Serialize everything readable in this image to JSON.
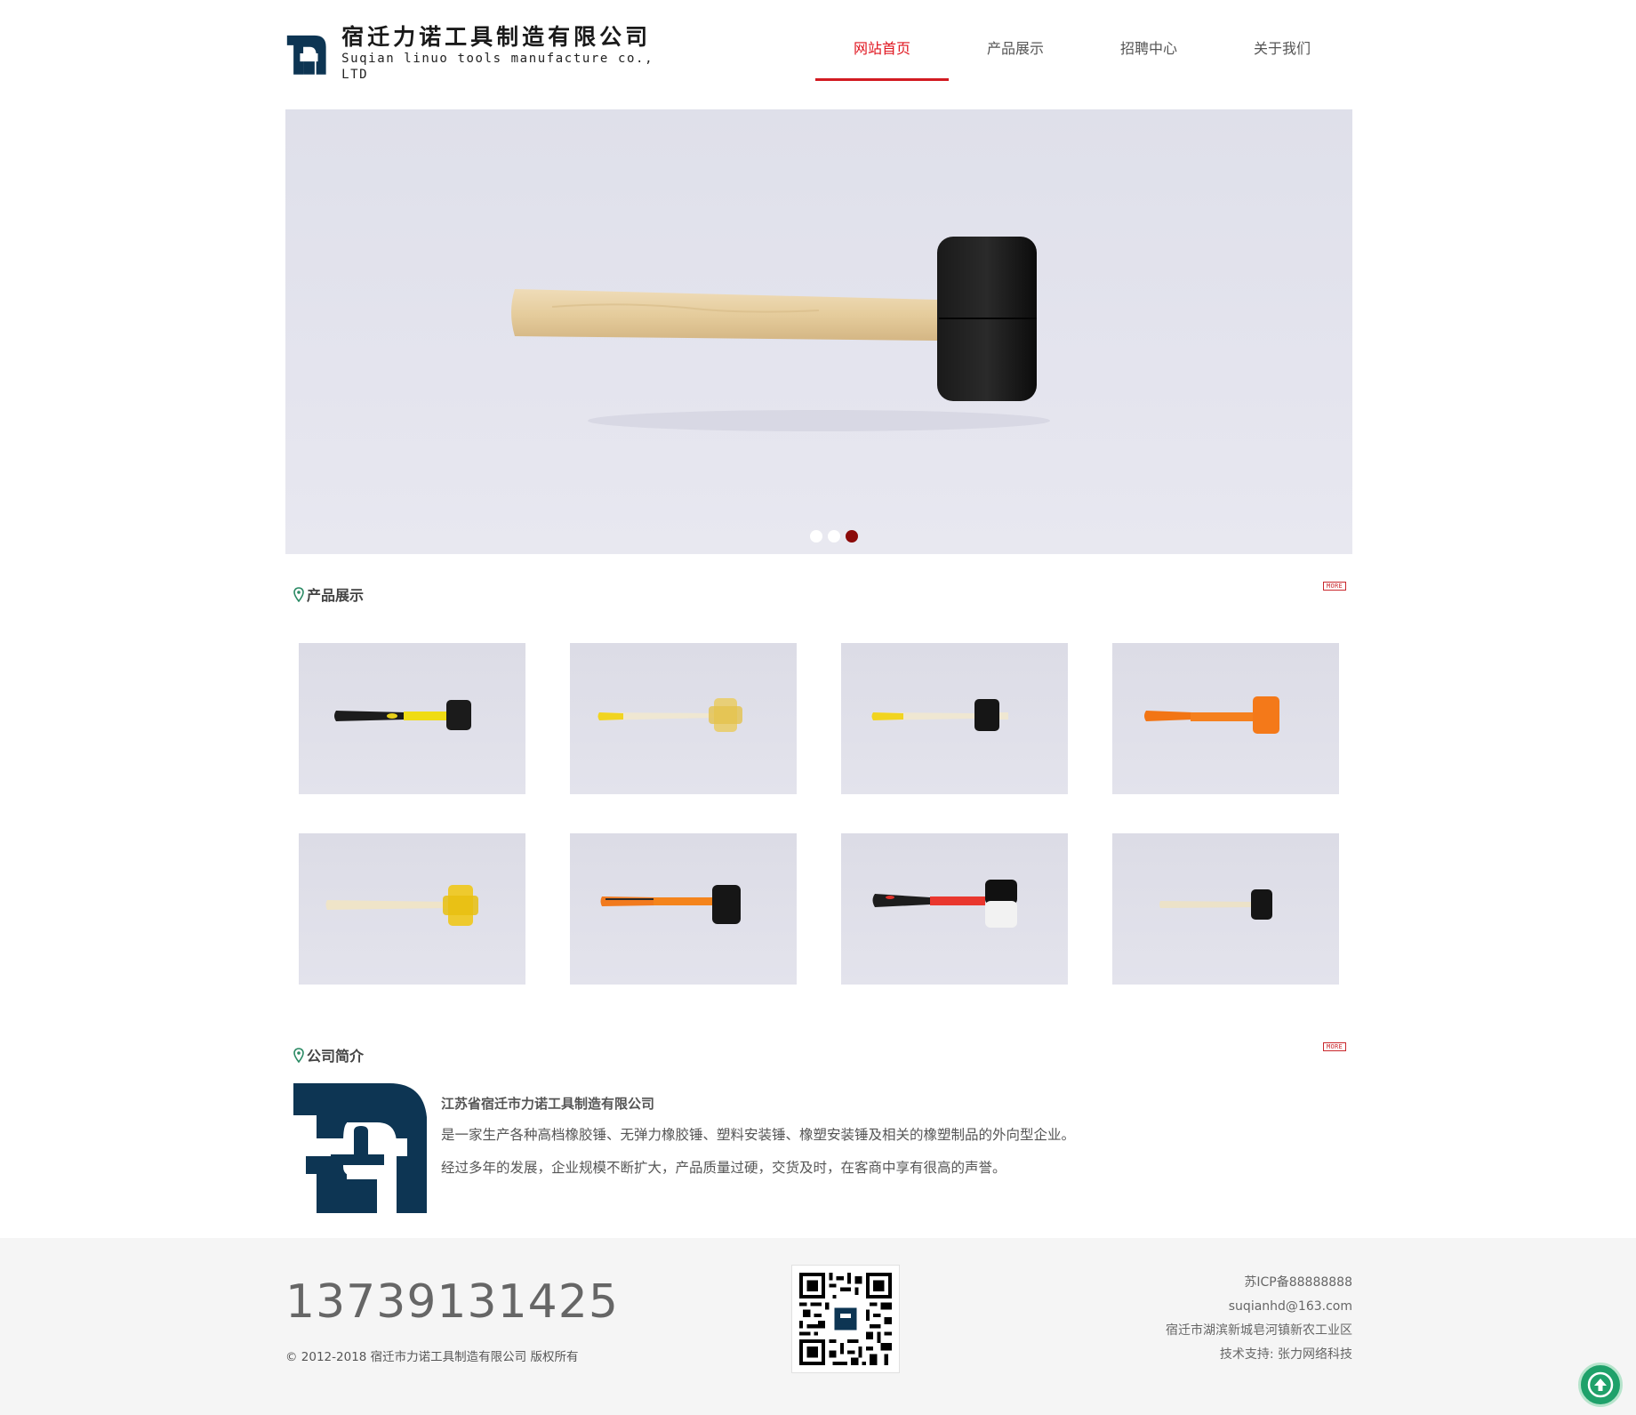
{
  "header": {
    "logo_cn": "宿迁力诺工具制造有限公司",
    "logo_en": "Suqian linuo tools manufacture co., LTD",
    "nav": [
      {
        "label": "网站首页",
        "active": true
      },
      {
        "label": "产品展示",
        "active": false
      },
      {
        "label": "招聘中心",
        "active": false
      },
      {
        "label": "关于我们",
        "active": false
      }
    ]
  },
  "hero": {
    "slides": 3,
    "active_slide": 3
  },
  "products_section": {
    "title": "产品展示",
    "more_label": "MORE",
    "items": [
      {
        "icon": "hammer-black-yellow-handle"
      },
      {
        "icon": "hammer-clear-yellow-wood-handle"
      },
      {
        "icon": "hammer-black-wood-handle"
      },
      {
        "icon": "hammer-orange"
      },
      {
        "icon": "hammer-clear-yellow-wood-handle"
      },
      {
        "icon": "hammer-black-orange-handle"
      },
      {
        "icon": "hammer-black-white-red-handle"
      },
      {
        "icon": "hammer-black-wood-handle-small"
      }
    ]
  },
  "about_section": {
    "title": "公司简介",
    "more_label": "MORE",
    "company_name": "江苏省宿迁市力诺工具制造有限公司",
    "paragraph_1": "是一家生产各种高档橡胶锤、无弹力橡胶锤、塑料安装锤、橡塑安装锤及相关的橡塑制品的外向型企业。",
    "paragraph_2": "经过多年的发展，企业规模不断扩大，产品质量过硬，交货及时，在客商中享有很高的声誉。"
  },
  "footer": {
    "phone": "13739131425",
    "copyright": "© 2012-2018 宿迁市力诺工具制造有限公司 版权所有",
    "icp": "苏ICP备88888888",
    "email": "suqianhd@163.com",
    "address": "宿迁市湖滨新城皂河镇新农工业区",
    "tech_support": "技术支持: 张力网络科技"
  },
  "colors": {
    "accent_red": "#d21a21",
    "logo_navy": "#0d3553",
    "back_to_top_green": "#1fa16a"
  }
}
